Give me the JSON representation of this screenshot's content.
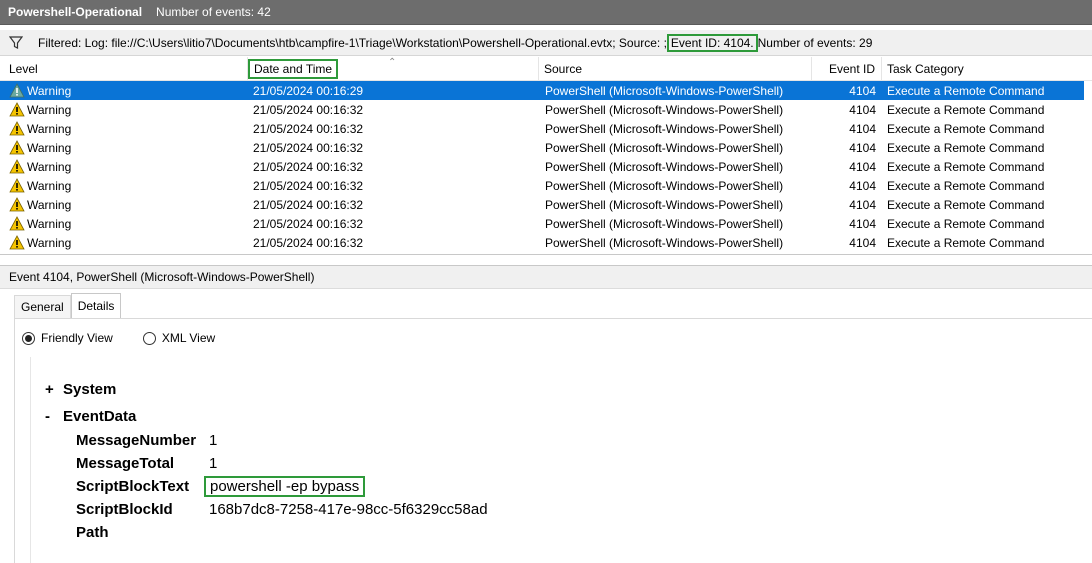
{
  "titlebar": {
    "title": "Powershell-Operational",
    "count": "Number of events: 42"
  },
  "filterbar": {
    "prefix": "Filtered: Log: file://C:\\Users\\litio7\\Documents\\htb\\campfire-1\\Triage\\Workstation\\Powershell-Operational.evtx; Source: ;",
    "highlight": "Event ID: 4104.",
    "suffix": " Number of events: 29",
    "icon": "filter-icon"
  },
  "grid": {
    "columns": {
      "level": "Level",
      "date": "Date and Time",
      "source": "Source",
      "event_id": "Event ID",
      "task": "Task Category"
    },
    "rows": [
      {
        "level": "Warning",
        "date": "21/05/2024 00:16:29",
        "source": "PowerShell (Microsoft-Windows-PowerShell)",
        "event_id": "4104",
        "task": "Execute a Remote Command"
      },
      {
        "level": "Warning",
        "date": "21/05/2024 00:16:32",
        "source": "PowerShell (Microsoft-Windows-PowerShell)",
        "event_id": "4104",
        "task": "Execute a Remote Command"
      },
      {
        "level": "Warning",
        "date": "21/05/2024 00:16:32",
        "source": "PowerShell (Microsoft-Windows-PowerShell)",
        "event_id": "4104",
        "task": "Execute a Remote Command"
      },
      {
        "level": "Warning",
        "date": "21/05/2024 00:16:32",
        "source": "PowerShell (Microsoft-Windows-PowerShell)",
        "event_id": "4104",
        "task": "Execute a Remote Command"
      },
      {
        "level": "Warning",
        "date": "21/05/2024 00:16:32",
        "source": "PowerShell (Microsoft-Windows-PowerShell)",
        "event_id": "4104",
        "task": "Execute a Remote Command"
      },
      {
        "level": "Warning",
        "date": "21/05/2024 00:16:32",
        "source": "PowerShell (Microsoft-Windows-PowerShell)",
        "event_id": "4104",
        "task": "Execute a Remote Command"
      },
      {
        "level": "Warning",
        "date": "21/05/2024 00:16:32",
        "source": "PowerShell (Microsoft-Windows-PowerShell)",
        "event_id": "4104",
        "task": "Execute a Remote Command"
      },
      {
        "level": "Warning",
        "date": "21/05/2024 00:16:32",
        "source": "PowerShell (Microsoft-Windows-PowerShell)",
        "event_id": "4104",
        "task": "Execute a Remote Command"
      },
      {
        "level": "Warning",
        "date": "21/05/2024 00:16:32",
        "source": "PowerShell (Microsoft-Windows-PowerShell)",
        "event_id": "4104",
        "task": "Execute a Remote Command"
      }
    ]
  },
  "detail": {
    "title": "Event 4104, PowerShell (Microsoft-Windows-PowerShell)",
    "tabs": [
      "General",
      "Details"
    ],
    "radios": {
      "friendly": "Friendly View",
      "xml": "XML View"
    },
    "tree": {
      "system_toggle": "+",
      "system_label": "System",
      "eventdata_toggle": "-",
      "eventdata_label": "EventData",
      "fields": [
        {
          "name": "MessageNumber",
          "value": "1"
        },
        {
          "name": "MessageTotal",
          "value": "1"
        },
        {
          "name": "ScriptBlockText",
          "value": "powershell -ep bypass"
        },
        {
          "name": "ScriptBlockId",
          "value": "168b7dc8-7258-417e-98cc-5f6329cc58ad"
        },
        {
          "name": "Path",
          "value": ""
        }
      ]
    }
  },
  "colors": {
    "selection": "#0a74d6",
    "highlight_border": "#2e9a3a",
    "warning": "#f5c400"
  }
}
